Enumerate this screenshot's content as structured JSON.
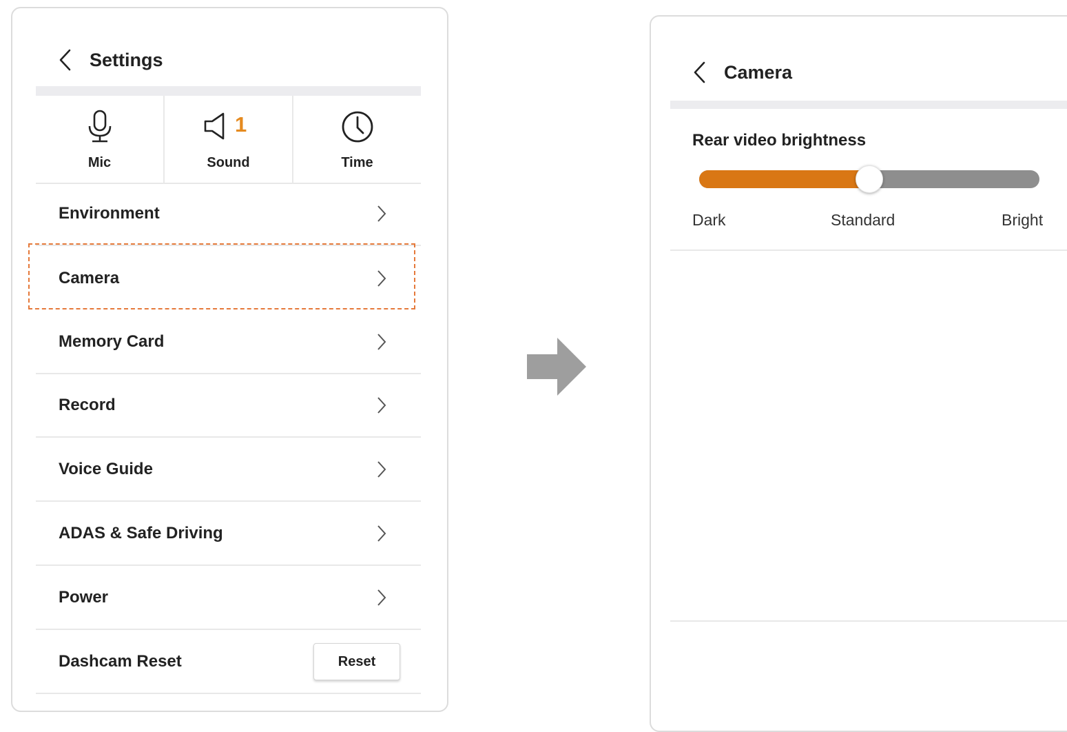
{
  "left_screen": {
    "title": "Settings",
    "quick_settings": [
      {
        "label": "Mic",
        "icon": "microphone-icon"
      },
      {
        "label": "Sound",
        "icon": "speaker-icon",
        "badge": "1"
      },
      {
        "label": "Time",
        "icon": "clock-icon"
      }
    ],
    "menu": [
      {
        "label": "Environment"
      },
      {
        "label": "Camera",
        "highlighted": true
      },
      {
        "label": "Memory Card"
      },
      {
        "label": "Record"
      },
      {
        "label": "Voice Guide"
      },
      {
        "label": "ADAS & Safe Driving"
      },
      {
        "label": "Power"
      }
    ],
    "reset_row": {
      "label": "Dashcam Reset",
      "button": "Reset"
    }
  },
  "right_screen": {
    "title": "Camera",
    "setting_label": "Rear video brightness",
    "slider": {
      "value_fraction": 0.5,
      "min_label": "Dark",
      "mid_label": "Standard",
      "max_label": "Bright"
    }
  },
  "colors": {
    "accent": "#d97714",
    "highlight_border": "#e5793a",
    "track": "#8e8e8e",
    "transition_arrow": "#9e9e9e"
  }
}
